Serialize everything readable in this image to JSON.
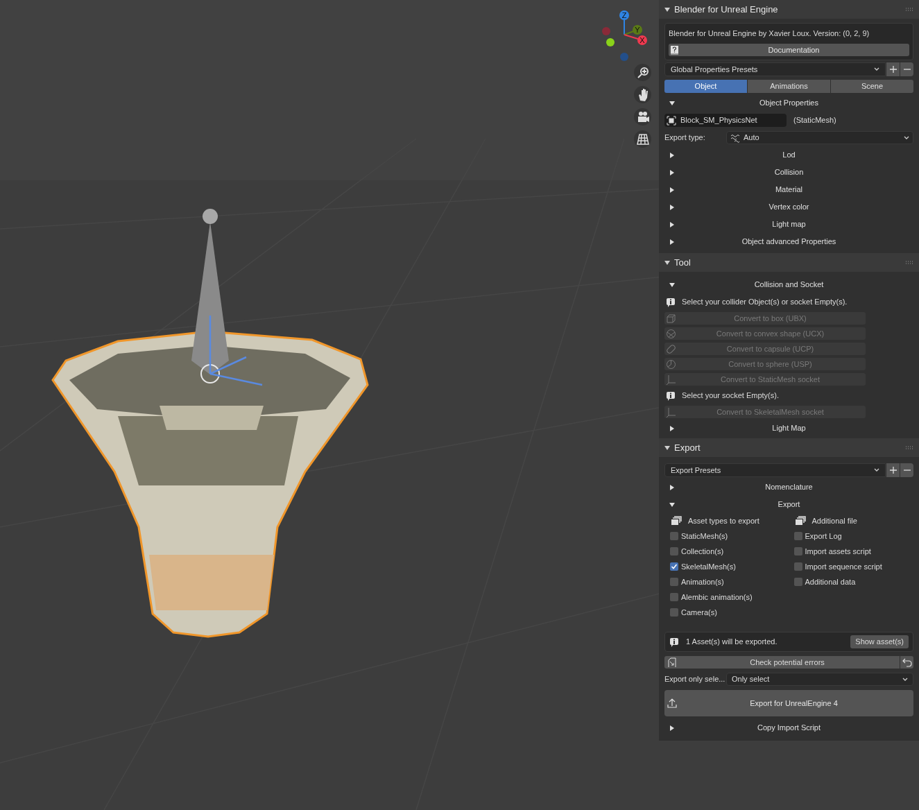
{
  "viewport": {
    "kind": "picture",
    "gizmo_axes": [
      {
        "label": "Z",
        "color": "#2f84e3"
      },
      {
        "label": "Y",
        "color": "#5a7a16"
      },
      {
        "label": "X",
        "color": "#f0394f"
      }
    ]
  },
  "panel": {
    "sections": [
      {
        "kind": "addon",
        "title": "Blender for Unreal Engine",
        "expanded": true,
        "info": "Blender for Unreal Engine by Xavier Loux. Version: (0, 2, 9)",
        "doc_button": "Documentation",
        "presets": "Global Properties Presets",
        "tabs": [
          {
            "label": "Object",
            "selected": true
          },
          {
            "label": "Animations",
            "selected": false
          },
          {
            "label": "Scene",
            "selected": false
          }
        ],
        "subpanel": {
          "title": "Object Properties",
          "expanded": true,
          "object_name": "Block_SM_PhysicsNet",
          "object_type": "(StaticMesh)",
          "export_type_label": "Export type:",
          "export_type": "Auto"
        },
        "subpanels": [
          {
            "title": "Lod",
            "expanded": false
          },
          {
            "title": "Collision",
            "expanded": false
          },
          {
            "title": "Material",
            "expanded": false
          },
          {
            "title": "Vertex color",
            "expanded": false
          },
          {
            "title": "Light map",
            "expanded": false
          },
          {
            "title": "Object advanced Properties",
            "expanded": false
          }
        ]
      },
      {
        "kind": "tool",
        "title": "Tool",
        "expanded": true,
        "subpanel": {
          "title": "Collision and Socket",
          "expanded": true
        },
        "items": [
          {
            "kind": "info",
            "text": "Select your collider Object(s) or socket Empty(s)."
          },
          {
            "kind": "button",
            "label": "Convert to box (UBX)",
            "disabled": true
          },
          {
            "kind": "button",
            "label": "Convert to convex shape (UCX)",
            "disabled": true
          },
          {
            "kind": "button",
            "label": "Convert to capsule (UCP)",
            "disabled": true
          },
          {
            "kind": "button",
            "label": "Convert to sphere (USP)",
            "disabled": true
          },
          {
            "kind": "button",
            "label": "Convert to StaticMesh socket",
            "disabled": true
          },
          {
            "kind": "info",
            "text": "Select your socket Empty(s)."
          },
          {
            "kind": "button",
            "label": "Convert to SkeletalMesh socket",
            "disabled": true
          }
        ],
        "subpanels": [
          {
            "title": "Light Map",
            "expanded": false
          }
        ]
      },
      {
        "kind": "export",
        "title": "Export",
        "expanded": true,
        "presets": "Export Presets",
        "subpanels": [
          {
            "title": "Nomenclature",
            "expanded": false
          },
          {
            "title": "Export",
            "expanded": true
          }
        ],
        "columns": [
          {
            "title": "Asset types to export",
            "options": [
              {
                "label": "StaticMesh(s)",
                "checked": false
              },
              {
                "label": "Collection(s)",
                "checked": false
              },
              {
                "label": "SkeletalMesh(s)",
                "checked": true
              },
              {
                "label": "Animation(s)",
                "checked": false
              },
              {
                "label": "Alembic animation(s)",
                "checked": false
              },
              {
                "label": "Camera(s)",
                "checked": false
              }
            ]
          },
          {
            "title": "Additional file",
            "options": [
              {
                "label": "Export Log",
                "checked": false
              },
              {
                "label": "Import assets script",
                "checked": false
              },
              {
                "label": "Import sequence script",
                "checked": false
              },
              {
                "label": "Additional data",
                "checked": false
              }
            ]
          }
        ],
        "summary": "1 Asset(s) will be exported.",
        "show_button": "Show asset(s)",
        "check_button": "Check potential errors",
        "only_label": "Export only sele...",
        "only_value": "Only select",
        "export_button": "Export for UnrealEngine 4",
        "footer": {
          "title": "Copy Import Script",
          "expanded": false
        }
      }
    ]
  }
}
